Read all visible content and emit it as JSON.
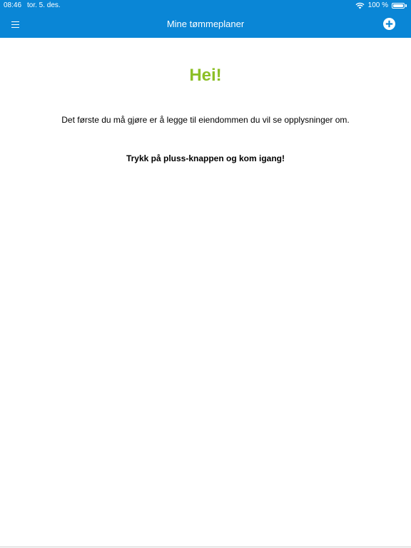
{
  "status_bar": {
    "time": "08:46",
    "date": "tor. 5. des.",
    "battery_level": "100 %"
  },
  "header": {
    "title": "Mine tømmeplaner",
    "menu_icon": "hamburger-icon",
    "add_icon": "plus-circle-icon"
  },
  "main": {
    "greeting": "Hei!",
    "intro": "Det første du må gjøre er å legge til eiendommen du vil se opplysninger om.",
    "call_to_action": "Trykk på pluss-knappen og kom igang!"
  },
  "colors": {
    "header_background": "#0a86d6",
    "greeting": "#8cbf26",
    "text": "#000000",
    "background": "#ffffff"
  }
}
